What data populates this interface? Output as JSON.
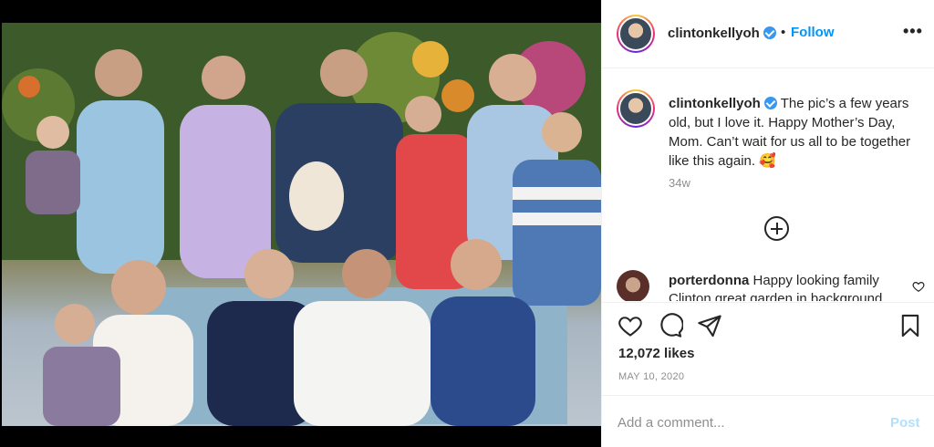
{
  "post": {
    "username": "clintonkellyoh",
    "follow_label": "Follow",
    "separator": "•",
    "more_label": "•••",
    "caption_text": "The pic’s a few years old, but I love it. Happy Mother’s Day, Mom. Can’t wait for us all to be together like this again. 🥰",
    "time_ago": "34w",
    "likes": "12,072 likes",
    "date": "MAY 10, 2020"
  },
  "comment": {
    "username": "porterdonna",
    "text": "Happy looking family Clinton great garden in background"
  },
  "add_comment": {
    "placeholder": "Add a comment...",
    "post_label": "Post"
  },
  "icons": {
    "like": "heart-icon",
    "comment": "comment-bubble-icon",
    "share": "paper-plane-icon",
    "save": "bookmark-icon",
    "load_more": "plus-circle-icon",
    "verified": "verified-badge-icon",
    "options": "more-options-icon"
  },
  "colors": {
    "link_blue": "#0095f6",
    "verified_blue": "#3897f0",
    "muted_gray": "#8e8e8e",
    "post_disabled": "#b2dffc"
  }
}
